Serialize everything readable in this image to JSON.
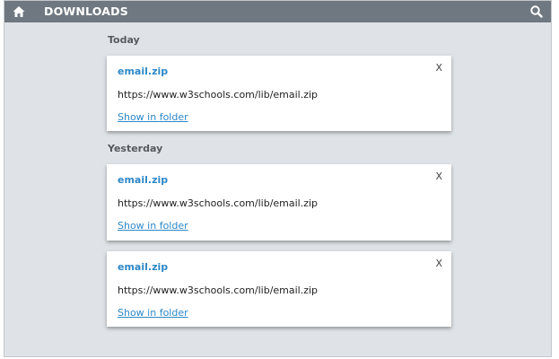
{
  "header": {
    "title": "DOWNLOADS",
    "home_icon": "home-icon",
    "search_icon": "search-icon",
    "bar_color": "#6f7880"
  },
  "sections": [
    {
      "heading": "Today",
      "items": [
        {
          "name": "email.zip",
          "url": "https://www.w3schools.com/lib/email.zip",
          "action": "Show in folder",
          "close": "X"
        }
      ]
    },
    {
      "heading": "Yesterday",
      "items": [
        {
          "name": "email.zip",
          "url": "https://www.w3schools.com/lib/email.zip",
          "action": "Show in folder",
          "close": "X"
        },
        {
          "name": "email.zip",
          "url": "https://www.w3schools.com/lib/email.zip",
          "action": "Show in folder",
          "close": "X"
        }
      ]
    }
  ],
  "colors": {
    "accent": "#2d88c7",
    "background": "#dfe3e7"
  }
}
